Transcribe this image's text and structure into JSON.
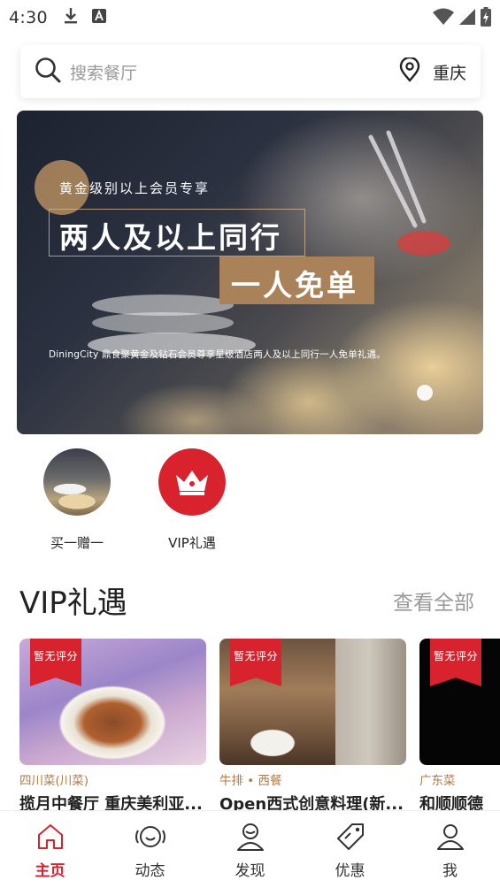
{
  "status_bar": {
    "time": "4:30",
    "left_icons": [
      "download-icon",
      "font-a-icon"
    ],
    "right_icons": [
      "wifi-icon",
      "cell-signal-icon",
      "battery-charging-icon"
    ]
  },
  "search": {
    "placeholder": "搜索餐厅",
    "city": "重庆"
  },
  "banner": {
    "tag": "黄金级别以上会员专享",
    "headline": "两人及以上同行",
    "subheadline": "一人免单",
    "description": "DiningCity 鼎食聚黄金及钻石会员尊享星级酒店两人及以上同行一人免单礼遇。",
    "current_slide": 1
  },
  "quick_entries": [
    {
      "label": "买一赠一",
      "icon": "food-photo-icon"
    },
    {
      "label": "VIP礼遇",
      "icon": "crown-icon"
    }
  ],
  "vip_section": {
    "title": "VIP礼遇",
    "view_all": "查看全部"
  },
  "restaurants": [
    {
      "ribbon": "暂无评分",
      "category": "四川菜(川菜)",
      "name": "揽月中餐厅 重庆美利亚..."
    },
    {
      "ribbon": "暂无评分",
      "category": "牛排 • 西餐",
      "name": "Open西式创意料理(新..."
    },
    {
      "ribbon": "暂无评分",
      "category": "广东菜",
      "name": "和顺顺德"
    }
  ],
  "tabs": [
    {
      "label": "主页",
      "icon": "home-icon",
      "active": true
    },
    {
      "label": "动态",
      "icon": "feed-icon",
      "active": false
    },
    {
      "label": "发现",
      "icon": "discover-icon",
      "active": false
    },
    {
      "label": "优惠",
      "icon": "coupon-icon",
      "active": false
    },
    {
      "label": "我",
      "icon": "profile-icon",
      "active": false
    }
  ],
  "colors": {
    "brand_red": "#d8232f",
    "gold": "#a98259",
    "category_text": "#b07a45"
  }
}
